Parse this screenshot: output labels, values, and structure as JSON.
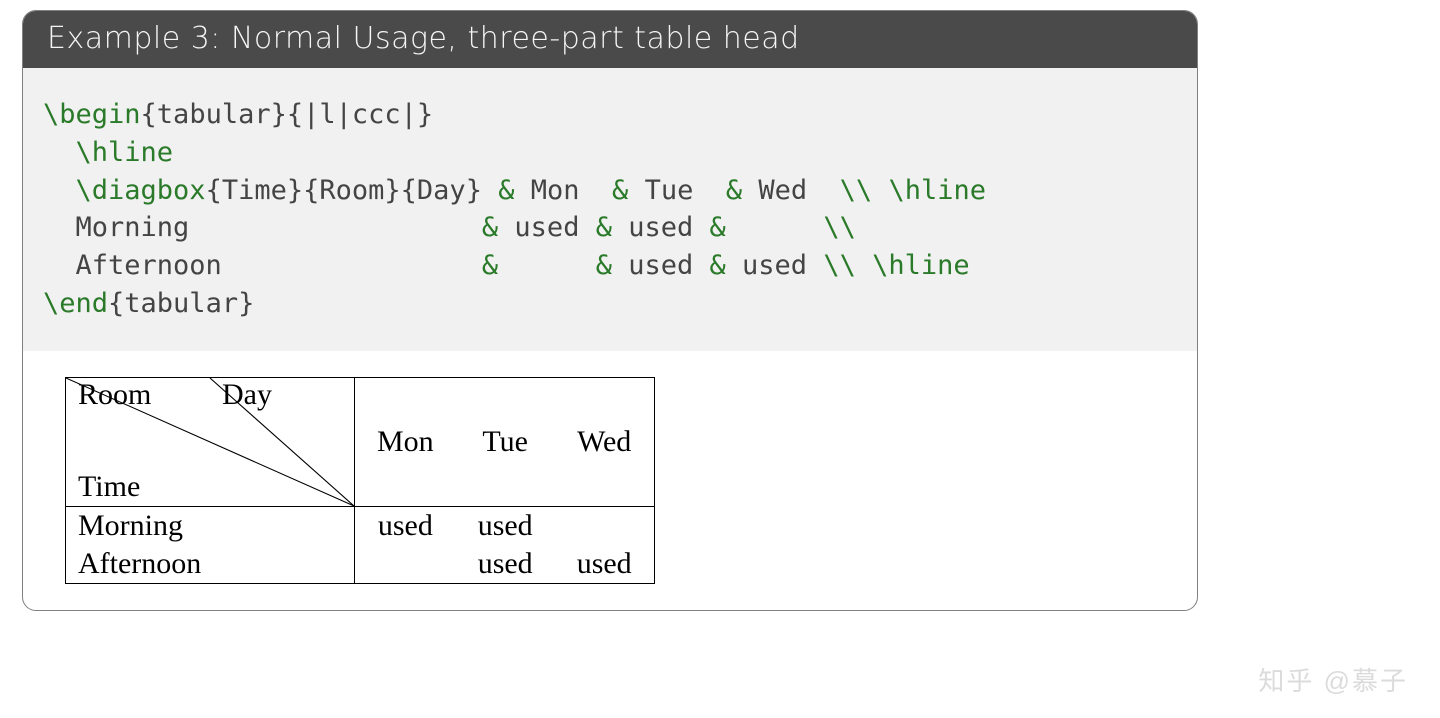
{
  "header": {
    "title": "Example 3:  Normal Usage, three-part table head"
  },
  "code": {
    "l1_cmd": "\\begin",
    "l1_arg": "{tabular}{|l|ccc|}",
    "l2_cmd": "\\hline",
    "l3_cmd": "\\diagbox",
    "l3_a1o": "{",
    "l3_a1": "Time",
    "l3_a1c": "}{",
    "l3_a2": "Room",
    "l3_a2c": "}{",
    "l3_a3": "Day",
    "l3_a3c": "}",
    "l3_amp1": " & ",
    "l3_v1": "Mon",
    "l3_amp2": "  & ",
    "l3_v2": "Tue",
    "l3_amp3": "  & ",
    "l3_v3": "Wed",
    "l3_endrow": "  \\\\ ",
    "l3_hline": "\\hline",
    "l4_label": "  Morning",
    "l4_amp1": "                  & ",
    "l4_v1": "used",
    "l4_amp2": " & ",
    "l4_v2": "used",
    "l4_amp3": " &",
    "l4_v3": "     ",
    "l4_endrow": " \\\\",
    "l5_label": "  Afternoon",
    "l5_amp1": "                &",
    "l5_v1": "     ",
    "l5_amp2": " & ",
    "l5_v2": "used",
    "l5_amp3": " & ",
    "l5_v3": "used",
    "l5_endrow": " \\\\ ",
    "l5_hline": "\\hline",
    "l6_cmd": "\\end",
    "l6_arg": "{tabular}"
  },
  "table": {
    "diag": {
      "top_left": "Room",
      "top_right": "Day",
      "bottom": "Time"
    },
    "columns": [
      "Mon",
      "Tue",
      "Wed"
    ],
    "rows": [
      {
        "label": "Morning",
        "cells": [
          "used",
          "used",
          ""
        ]
      },
      {
        "label": "Afternoon",
        "cells": [
          "",
          "used",
          "used"
        ]
      }
    ]
  },
  "watermark": "知乎 @慕子"
}
